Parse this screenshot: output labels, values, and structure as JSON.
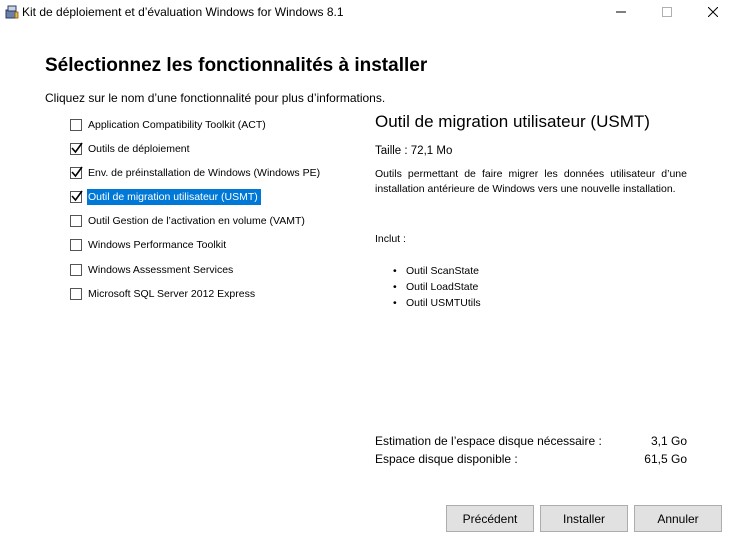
{
  "window": {
    "title": "Kit de déploiement et d’évaluation Windows for Windows 8.1",
    "controls": {
      "minimize_icon": "minimize-icon",
      "maximize_icon": "maximize-icon",
      "close_icon": "close-icon"
    }
  },
  "page": {
    "heading": "Sélectionnez les fonctionnalités à installer",
    "subheading": "Cliquez sur le nom d’une fonctionnalité pour plus d’informations."
  },
  "features": [
    {
      "label": "Application Compatibility Toolkit (ACT)",
      "checked": false,
      "selected": false
    },
    {
      "label": "Outils de déploiement",
      "checked": true,
      "selected": false
    },
    {
      "label": "Env. de préinstallation de Windows (Windows PE)",
      "checked": true,
      "selected": false
    },
    {
      "label": "Outil de migration utilisateur (USMT)",
      "checked": true,
      "selected": true
    },
    {
      "label": "Outil Gestion de l’activation en volume (VAMT)",
      "checked": false,
      "selected": false
    },
    {
      "label": "Windows Performance Toolkit",
      "checked": false,
      "selected": false
    },
    {
      "label": "Windows Assessment Services",
      "checked": false,
      "selected": false
    },
    {
      "label": "Microsoft SQL Server 2012 Express",
      "checked": false,
      "selected": false
    }
  ],
  "details": {
    "title": "Outil de migration utilisateur (USMT)",
    "size": "Taille : 72,1 Mo",
    "description": "Outils permettant de faire migrer les données utilisateur d’une installation antérieure de Windows vers une nouvelle installation.",
    "includes_label": "Inclut :",
    "includes": [
      "Outil ScanState",
      "Outil LoadState",
      "Outil USMTUtils"
    ]
  },
  "disk": {
    "required_label": "Estimation de l’espace disque nécessaire :",
    "required_value": "3,1 Go",
    "available_label": "Espace disque disponible :",
    "available_value": "61,5 Go"
  },
  "buttons": {
    "previous": "Précédent",
    "install": "Installer",
    "cancel": "Annuler"
  },
  "colors": {
    "selection": "#0078d7",
    "button_bg": "#e1e1e1",
    "button_border": "#adadad"
  }
}
